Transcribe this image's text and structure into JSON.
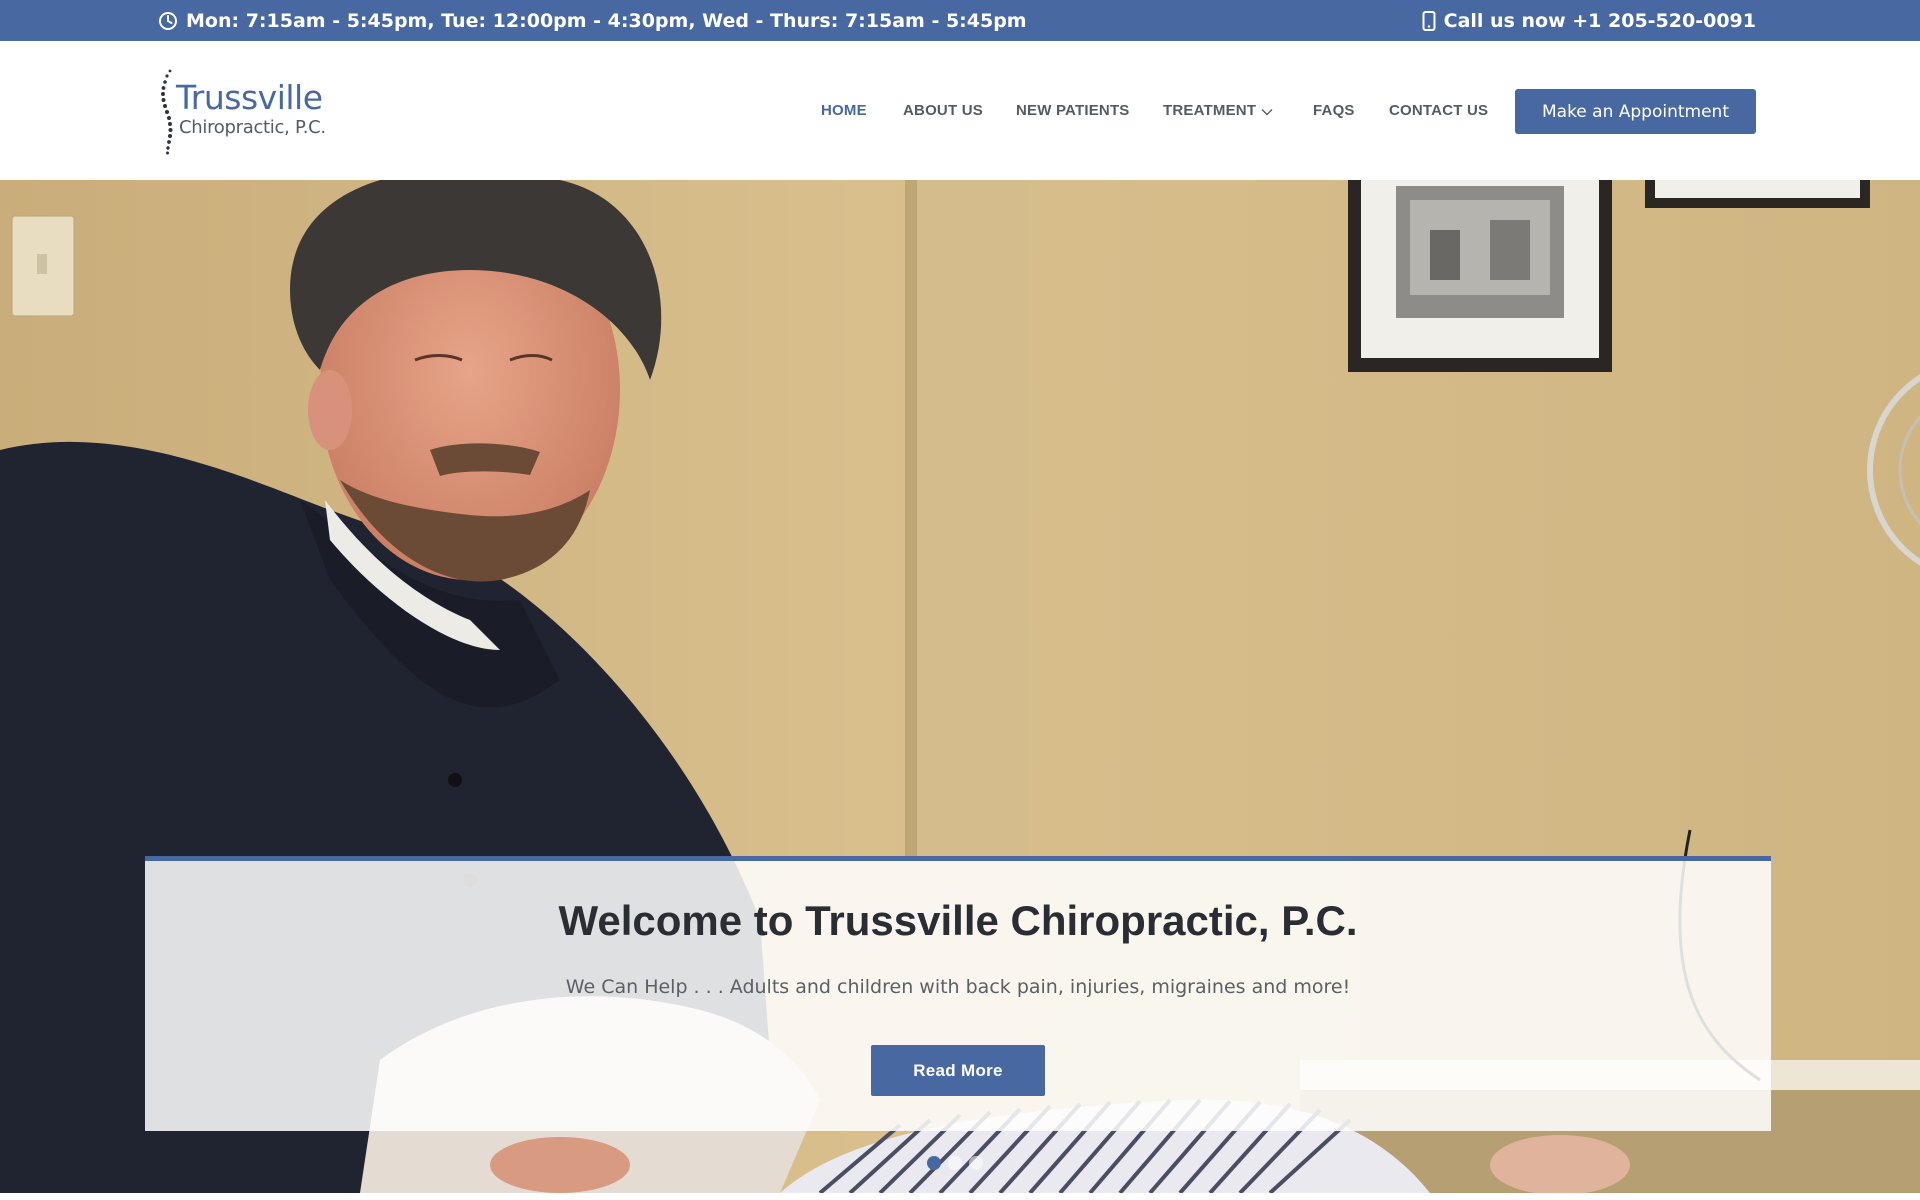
{
  "topbar": {
    "hours_icon": "clock-icon",
    "hours": "Mon: 7:15am - 5:45pm, Tue: 12:00pm - 4:30pm, Wed - Thurs: 7:15am - 5:45pm",
    "phone_icon": "mobile-phone-icon",
    "call": "Call us now +1 205-520-0091"
  },
  "logo": {
    "name": "Trussville",
    "sub": "Chiropractic, P.C."
  },
  "nav": {
    "items": [
      {
        "label": "HOME",
        "active": true
      },
      {
        "label": "ABOUT US"
      },
      {
        "label": "NEW PATIENTS"
      },
      {
        "label": "TREATMENT",
        "has_dropdown": true
      },
      {
        "label": "FAQS"
      },
      {
        "label": "CONTACT US"
      }
    ],
    "cta": "Make an Appointment"
  },
  "hero": {
    "title": "Welcome to Trussville Chiropractic, P.C.",
    "subtitle": "We Can Help . . . Adults and children with back pain, injuries, migraines and more!",
    "button": "Read More",
    "slides": 3,
    "active_slide": 1
  },
  "colors": {
    "brand": "#4868a2",
    "text_dark": "#2a2d33",
    "text_nav": "#555a66"
  }
}
